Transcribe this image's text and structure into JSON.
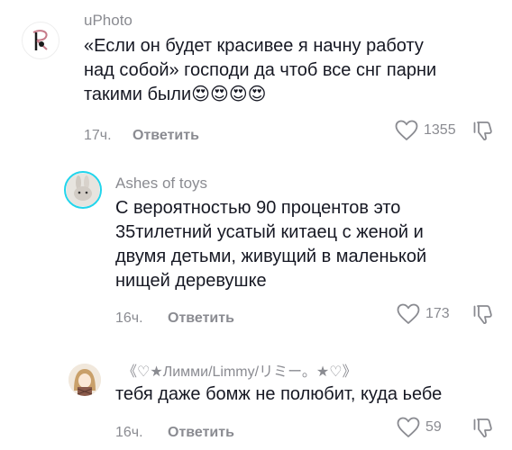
{
  "comments": [
    {
      "username": "uPhoto",
      "text_lines": [
        "«Если он будет красивее я начну работу",
        "над собой» господи да чтоб все снг парни",
        "такими были😍😍😍😍"
      ],
      "time": "17ч.",
      "reply_label": "Ответить",
      "likes": "1355"
    },
    {
      "username": "Ashes of toys",
      "text_lines": [
        "С вероятностью 90 процентов это",
        "35тилетний усатый китаец с женой и",
        "двумя детьми, живущий в маленькой",
        "нищей деревушке"
      ],
      "time": "16ч.",
      "reply_label": "Ответить",
      "likes": "173"
    },
    {
      "username": "《♡★Лимми/Limmy/リミー。★♡》",
      "text_lines": [
        "тебя даже бомж не полюбит, куда ьебе"
      ],
      "time": "16ч.",
      "reply_label": "Ответить",
      "likes": "59"
    }
  ],
  "icons": {
    "like": "heart-outline-icon",
    "dislike": "thumbs-down-outline-icon"
  },
  "colors": {
    "text": "#161823",
    "secondary": "#8a8b91",
    "avatar_ring": "#20d5ec"
  }
}
